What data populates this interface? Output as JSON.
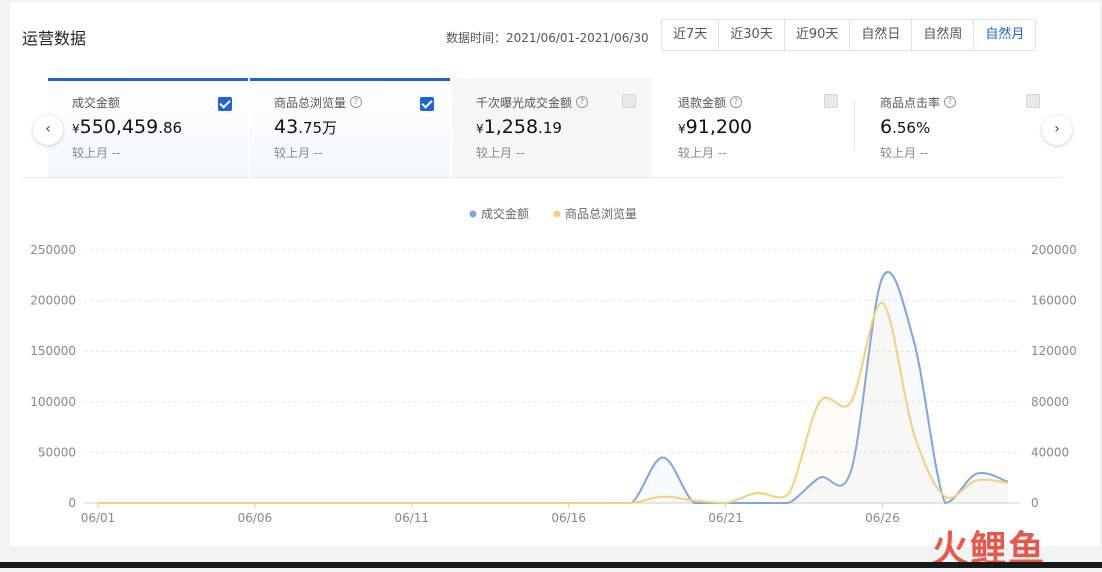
{
  "header": {
    "title": "运营数据",
    "date_label": "数据时间：",
    "date_value": "2021/06/01-2021/06/30",
    "periods": [
      "近7天",
      "近30天",
      "近90天",
      "自然日",
      "自然周",
      "自然月"
    ],
    "active_period": "自然月"
  },
  "metrics": [
    {
      "label": "成交金额",
      "currency": "¥",
      "int": "550,459",
      "dec": ".86",
      "unit": "",
      "compare_label": "较上月",
      "compare_value": "--",
      "checked": true,
      "help": false
    },
    {
      "label": "商品总浏览量",
      "currency": "",
      "int": "43",
      "dec": ".75",
      "unit": "万",
      "compare_label": "较上月",
      "compare_value": "--",
      "checked": true,
      "help": true
    },
    {
      "label": "千次曝光成交金额",
      "currency": "¥",
      "int": "1,258",
      "dec": ".19",
      "unit": "",
      "compare_label": "较上月",
      "compare_value": "--",
      "checked": false,
      "help": true
    },
    {
      "label": "退款金额",
      "currency": "¥",
      "int": "91,200",
      "dec": "",
      "unit": "",
      "compare_label": "较上月",
      "compare_value": "--",
      "checked": false,
      "help": true
    },
    {
      "label": "商品点击率",
      "currency": "",
      "int": "6",
      "dec": ".56",
      "unit": "%",
      "compare_label": "较上月",
      "compare_value": "--",
      "checked": false,
      "help": true
    }
  ],
  "nav": {
    "prev_icon": "chevron-left-icon",
    "next_icon": "chevron-right-icon"
  },
  "colors": {
    "accent": "#1f63d8",
    "series_gmv": "#7ba4ea",
    "series_views": "#f7cf7c"
  },
  "watermark": "火鲤鱼",
  "chart_data": {
    "type": "line",
    "x": [
      "06/01",
      "06/02",
      "06/03",
      "06/04",
      "06/05",
      "06/06",
      "06/07",
      "06/08",
      "06/09",
      "06/10",
      "06/11",
      "06/12",
      "06/13",
      "06/14",
      "06/15",
      "06/16",
      "06/17",
      "06/18",
      "06/19",
      "06/20",
      "06/21",
      "06/22",
      "06/23",
      "06/24",
      "06/25",
      "06/26",
      "06/27",
      "06/28",
      "06/29",
      "06/30"
    ],
    "x_ticks": [
      "06/01",
      "06/06",
      "06/11",
      "06/16",
      "06/21",
      "06/26"
    ],
    "series": [
      {
        "name": "成交金额",
        "axis": "left",
        "color": "#7ba4ea",
        "values": [
          0,
          0,
          0,
          0,
          0,
          0,
          0,
          0,
          0,
          0,
          0,
          0,
          0,
          0,
          0,
          0,
          0,
          0,
          45000,
          0,
          0,
          0,
          0,
          25000,
          32000,
          223000,
          160000,
          0,
          29000,
          21000
        ]
      },
      {
        "name": "商品总浏览量",
        "axis": "right",
        "color": "#f7cf7c",
        "values": [
          0,
          0,
          0,
          0,
          0,
          0,
          0,
          0,
          0,
          0,
          0,
          0,
          0,
          0,
          0,
          0,
          0,
          0,
          5000,
          2000,
          0,
          8000,
          7000,
          80000,
          80000,
          158000,
          55000,
          5000,
          18000,
          16000
        ]
      }
    ],
    "y_left": {
      "min": 0,
      "max": 250000,
      "ticks": [
        0,
        50000,
        100000,
        150000,
        200000,
        250000
      ]
    },
    "y_right": {
      "min": 0,
      "max": 200000,
      "ticks": [
        0,
        40000,
        80000,
        120000,
        160000,
        200000
      ]
    },
    "grid": true,
    "legend": "top-center"
  }
}
